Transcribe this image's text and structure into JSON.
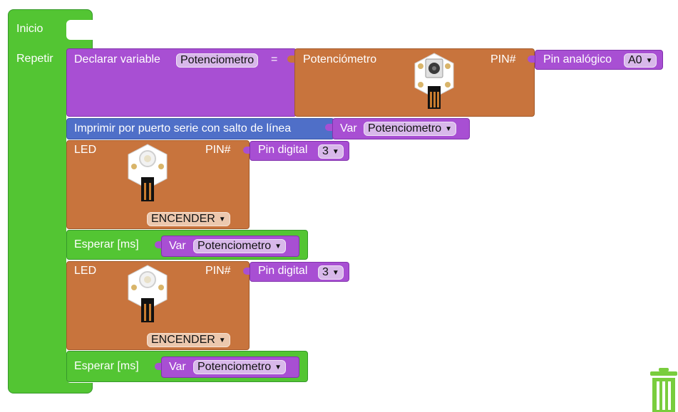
{
  "blocks": {
    "inicio": "Inicio",
    "repetir": "Repetir",
    "declarar": {
      "label": "Declarar variable",
      "var_name": "Potenciometro",
      "equals": "="
    },
    "potenciometro": {
      "label": "Potenciómetro",
      "pin_label": "PIN#",
      "pin_type": "Pin analógico",
      "pin_value": "A0"
    },
    "imprimir": {
      "label": "Imprimir por puerto serie con salto de línea",
      "var_label": "Var",
      "var_value": "Potenciometro"
    },
    "led1": {
      "label": "LED",
      "pin_label": "PIN#",
      "pin_type": "Pin digital",
      "pin_value": "3",
      "state": "ENCENDER"
    },
    "esperar1": {
      "label": "Esperar [ms]",
      "var_label": "Var",
      "var_value": "Potenciometro"
    },
    "led2": {
      "label": "LED",
      "pin_label": "PIN#",
      "pin_type": "Pin digital",
      "pin_value": "3",
      "state": "ENCENDER"
    },
    "esperar2": {
      "label": "Esperar [ms]",
      "var_label": "Var",
      "var_value": "Potenciometro"
    }
  },
  "icons": {
    "trash": "trash-icon",
    "potentiometer": "potentiometer-module-image",
    "led": "led-module-image"
  },
  "colors": {
    "control": "#53c533",
    "control_dark": "#36982b",
    "variable": "#a84fd3",
    "variable_dark": "#8232ad",
    "component": "#c8743d",
    "component_dark": "#a35a29",
    "serial": "#4f6fc8",
    "dropdown_purple": "#d8b8ea",
    "dropdown_orange": "#ecc8ae",
    "trash": "#79cd3d"
  }
}
